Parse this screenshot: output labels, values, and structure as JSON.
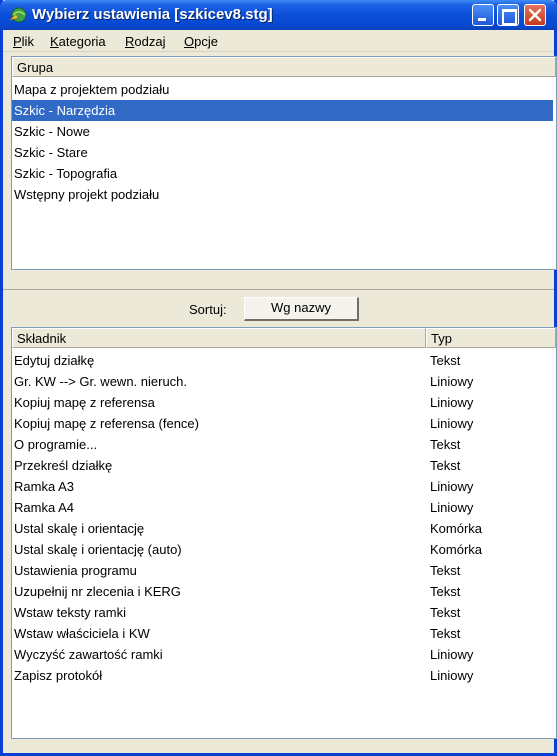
{
  "window": {
    "title": "Wybierz ustawienia [szkicev8.stg]",
    "accent": "#0a4fd9",
    "icon": "app-globe-icon"
  },
  "menu": [
    "Plik",
    "Kategoria",
    "Rodzaj",
    "Opcje"
  ],
  "groups": {
    "header": "Grupa",
    "items": [
      "Mapa z projektem podziału",
      "Szkic - Narzędzia",
      "Szkic - Nowe",
      "Szkic - Stare",
      "Szkic - Topografia",
      "Wstępny projekt podziału"
    ],
    "selected": "Szkic - Narzędzia",
    "selected_color": "#316ac5"
  },
  "sort": {
    "label": "Sortuj:",
    "button": "Wg nazwy"
  },
  "components": {
    "headers": {
      "name": "Składnik",
      "type": "Typ"
    },
    "rows": [
      {
        "name": "Edytuj działkę",
        "type": "Tekst"
      },
      {
        "name": "Gr. KW --> Gr. wewn. nieruch.",
        "type": "Liniowy"
      },
      {
        "name": "Kopiuj mapę z referensa",
        "type": "Liniowy"
      },
      {
        "name": "Kopiuj mapę z referensa (fence)",
        "type": "Liniowy"
      },
      {
        "name": "O programie...",
        "type": "Tekst"
      },
      {
        "name": "Przekreśl działkę",
        "type": "Tekst"
      },
      {
        "name": "Ramka A3",
        "type": "Liniowy"
      },
      {
        "name": "Ramka A4",
        "type": "Liniowy"
      },
      {
        "name": "Ustal skalę i orientację",
        "type": "Komórka"
      },
      {
        "name": "Ustal skalę i orientację (auto)",
        "type": "Komórka"
      },
      {
        "name": "Ustawienia programu",
        "type": "Tekst"
      },
      {
        "name": "Uzupełnij nr zlecenia i KERG",
        "type": "Tekst"
      },
      {
        "name": "Wstaw teksty ramki",
        "type": "Tekst"
      },
      {
        "name": "Wstaw właściciela i KW",
        "type": "Tekst"
      },
      {
        "name": "Wyczyść zawartość ramki",
        "type": "Liniowy"
      },
      {
        "name": "Zapisz protokół",
        "type": "Liniowy"
      }
    ]
  }
}
